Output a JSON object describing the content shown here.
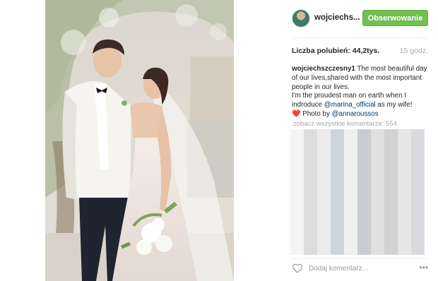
{
  "post": {
    "username": "wojciechs...",
    "follow_label": "Obserwowanie",
    "likes_label": "Liczba polubień: 44,2tys.",
    "time_label": "15 godz.",
    "caption": {
      "author": "wojciechszczesny1",
      "text_1": " The most beautiful day of our lives,shared with the most important people in our lives.",
      "text_2": "I'm the proudest man on earth when I indroduce ",
      "mention_1": "@marina_official",
      "text_3": " as my wife!",
      "emoji": "❤️",
      "text_4": " Photo by ",
      "mention_2": "@annaroussos"
    },
    "view_comments_label": "zobacz wszystkie komentarze: 554",
    "comment_placeholder": "Dodaj komentarz...",
    "more_label": "•••"
  },
  "icons": {
    "like": "heart-outline-icon",
    "more": "more-dots-icon",
    "heart_emoji": "heart-emoji-icon"
  },
  "colors": {
    "follow_button": "#70c050",
    "mention": "#003569",
    "muted": "#a5a7aa"
  }
}
